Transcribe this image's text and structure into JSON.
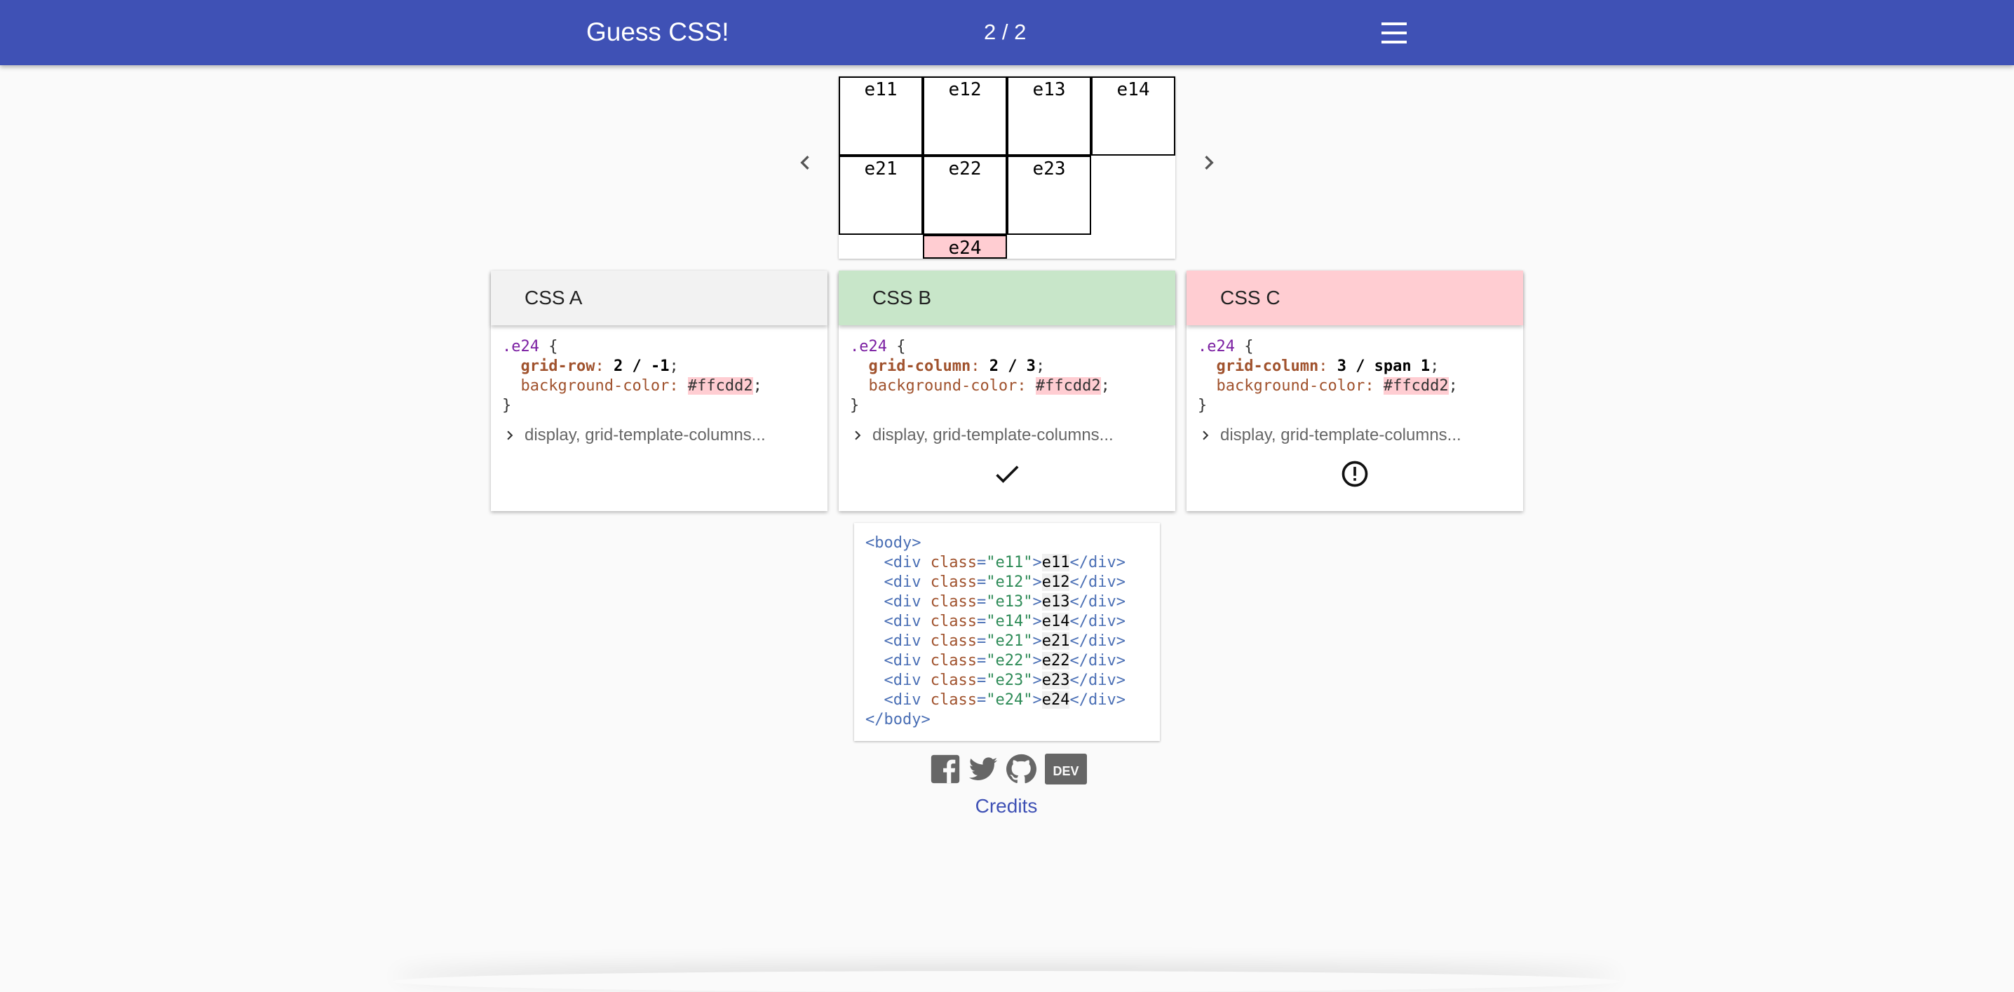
{
  "appbar": {
    "title": "Guess CSS!",
    "counter": "2 / 2"
  },
  "grid_preview": {
    "cells": [
      "e11",
      "e12",
      "e13",
      "e14",
      "e21",
      "e22",
      "e23",
      "e24"
    ],
    "highlight": {
      "cell": "e24",
      "color": "#ffcdd2"
    }
  },
  "cards": [
    {
      "title": "CSS A",
      "selector": ".e24",
      "open_brace": "{",
      "prop1": "grid-row",
      "val1": "2 / -1",
      "prop2": "background-color",
      "val2": "#ffcdd2",
      "close_brace": "}",
      "summary": "display, grid-template-columns...",
      "state": "unselected"
    },
    {
      "title": "CSS B",
      "selector": ".e24",
      "open_brace": "{",
      "prop1": "grid-column",
      "val1": "2 / 3",
      "prop2": "background-color",
      "val2": "#ffcdd2",
      "close_brace": "}",
      "summary": "display, grid-template-columns...",
      "state": "correct",
      "icon": "check-icon"
    },
    {
      "title": "CSS C",
      "selector": ".e24",
      "open_brace": "{",
      "prop1": "grid-column",
      "val1": "3 / span 1",
      "prop2": "background-color",
      "val2": "#ffcdd2",
      "close_brace": "}",
      "summary": "display, grid-template-columns...",
      "state": "wrong",
      "icon": "error-icon"
    }
  ],
  "html_source": {
    "open": "<body>",
    "close": "</body>",
    "rows": [
      {
        "cls": "e11",
        "text": "e11"
      },
      {
        "cls": "e12",
        "text": "e12"
      },
      {
        "cls": "e13",
        "text": "e13"
      },
      {
        "cls": "e14",
        "text": "e14"
      },
      {
        "cls": "e21",
        "text": "e21"
      },
      {
        "cls": "e22",
        "text": "e22"
      },
      {
        "cls": "e23",
        "text": "e23"
      },
      {
        "cls": "e24",
        "text": "e24"
      }
    ]
  },
  "footer": {
    "social": [
      "facebook-icon",
      "twitter-icon",
      "github-icon",
      "dev-icon"
    ],
    "dev_label": "DEV",
    "credits": "Credits"
  },
  "colors": {
    "appbar": "#3f51b5",
    "correct": "#c8e6c9",
    "wrong": "#ffcdd2",
    "link": "#3f51b5"
  }
}
